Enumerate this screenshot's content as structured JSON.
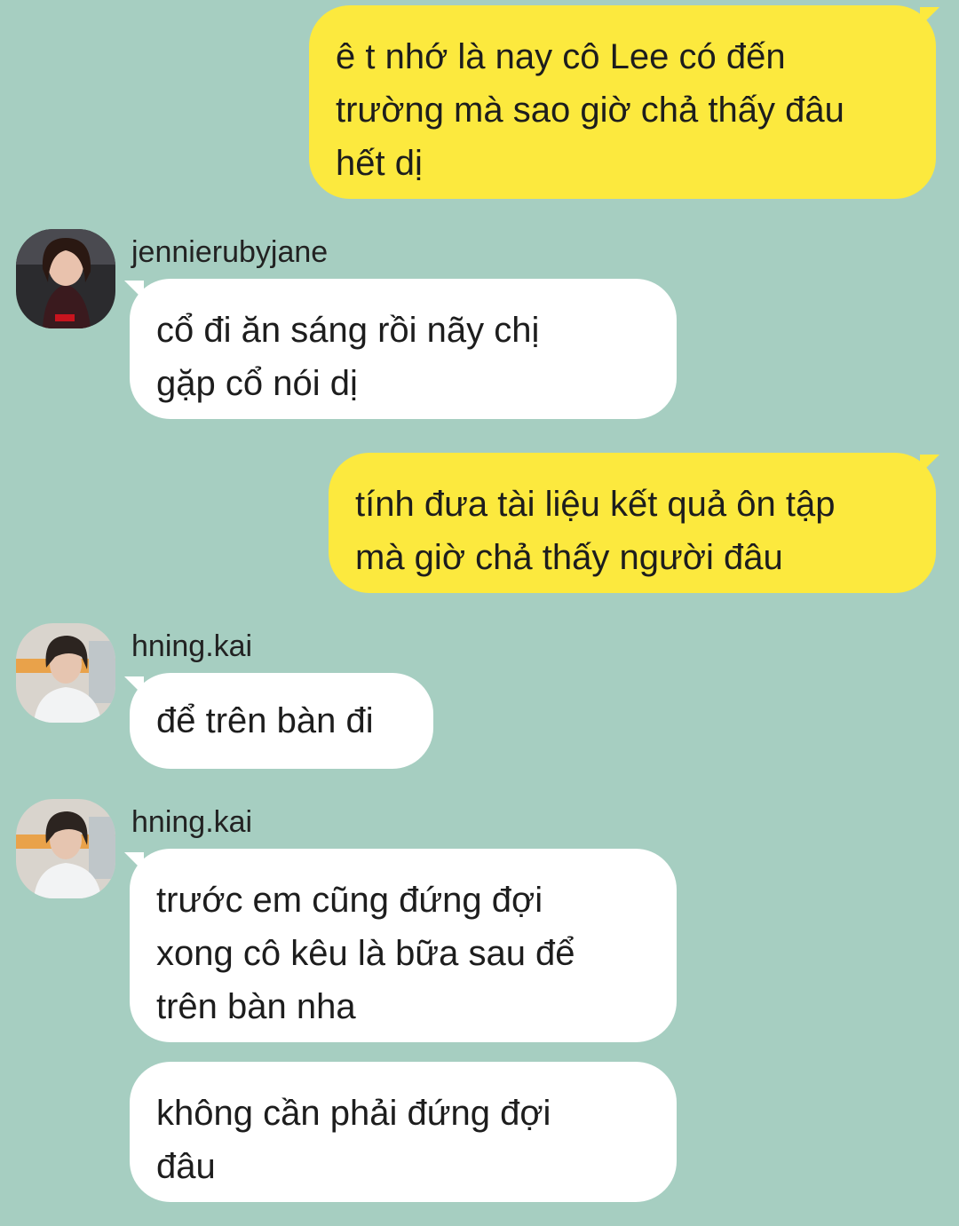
{
  "colors": {
    "background": "#a6cec1",
    "outgoing_bubble": "#fce93e",
    "incoming_bubble": "#ffffff",
    "text": "#1d1d1d"
  },
  "messages": [
    {
      "direction": "outgoing",
      "lines": [
        "ê t nhớ là nay cô Lee có đến",
        "trường mà sao giờ chả thấy đâu",
        "hết dị"
      ]
    },
    {
      "direction": "incoming",
      "sender": "jennierubyjane",
      "avatar": "avatar-photo-jennie",
      "lines": [
        "cổ đi ăn sáng rồi nãy chị",
        "gặp cổ nói dị"
      ]
    },
    {
      "direction": "outgoing",
      "lines": [
        "tính đưa tài liệu kết quả ôn tập",
        "mà giờ chả thấy người đâu"
      ]
    },
    {
      "direction": "incoming",
      "sender": "hning.kai",
      "avatar": "avatar-photo-kai",
      "lines": [
        "để trên bàn đi"
      ]
    },
    {
      "direction": "incoming",
      "sender": "hning.kai",
      "avatar": "avatar-photo-kai",
      "lines": [
        "trước em cũng đứng đợi",
        "xong cô kêu là bữa sau để",
        "trên bàn nha"
      ]
    },
    {
      "direction": "incoming",
      "continuation": true,
      "lines": [
        "không cần phải đứng đợi",
        "đâu"
      ]
    }
  ]
}
